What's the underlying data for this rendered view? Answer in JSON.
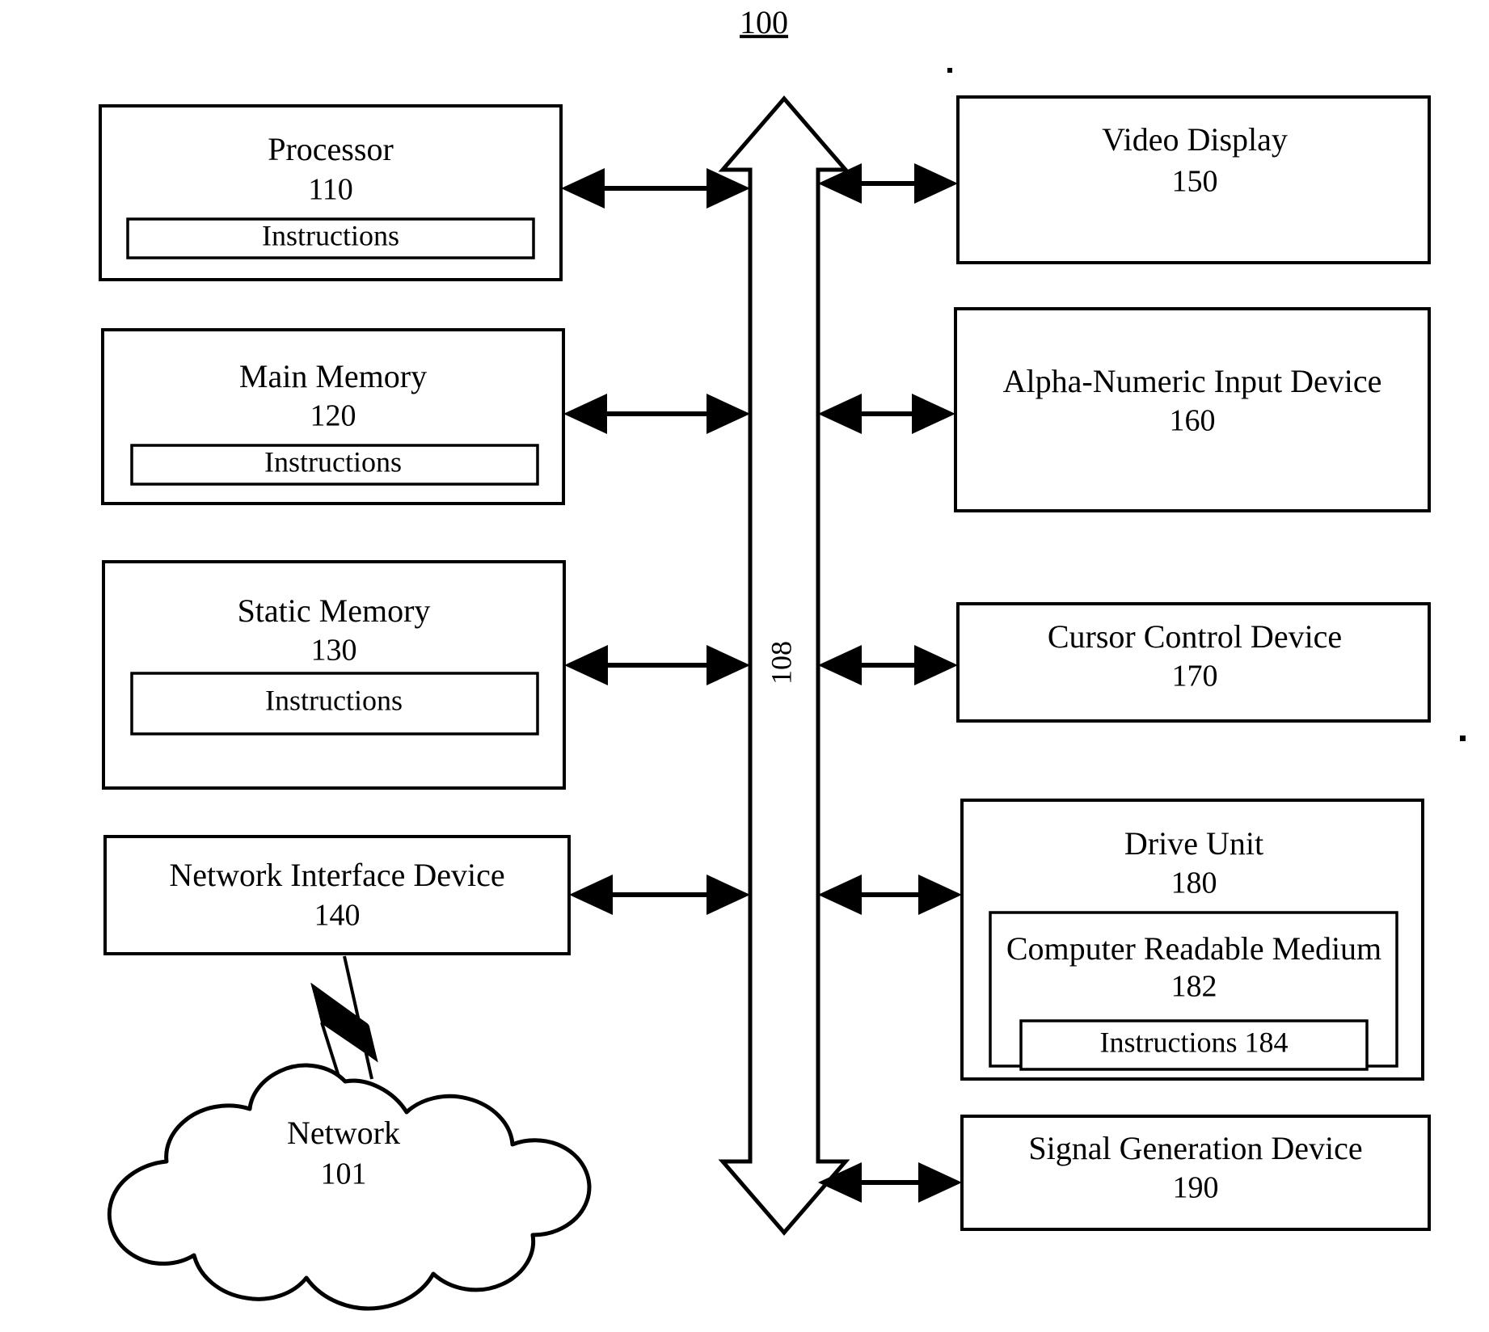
{
  "figure": {
    "number": "100",
    "description": "Computer system block diagram"
  },
  "bus": {
    "label": "108",
    "name": "system-bus"
  },
  "left_column": [
    {
      "id": "processor",
      "title": "Processor",
      "number": "110",
      "inner": {
        "label": "Instructions"
      }
    },
    {
      "id": "main-memory",
      "title": "Main Memory",
      "number": "120",
      "inner": {
        "label": "Instructions"
      }
    },
    {
      "id": "static-memory",
      "title": "Static Memory",
      "number": "130",
      "inner": {
        "label": "Instructions"
      }
    },
    {
      "id": "network-interface-device",
      "title": "Network Interface Device",
      "number": "140",
      "inner": null
    }
  ],
  "right_column": [
    {
      "id": "video-display",
      "title": "Video Display",
      "number": "150"
    },
    {
      "id": "alpha-numeric-input-device",
      "title": "Alpha-Numeric Input Device",
      "number": "160"
    },
    {
      "id": "cursor-control-device",
      "title": "Cursor Control Device",
      "number": "170"
    },
    {
      "id": "drive-unit",
      "title": "Drive Unit",
      "number": "180",
      "medium": {
        "title": "Computer Readable Medium",
        "number": "182",
        "instructions": "Instructions 184"
      }
    },
    {
      "id": "signal-generation-device",
      "title": "Signal Generation Device",
      "number": "190"
    }
  ],
  "network_cloud": {
    "title": "Network",
    "number": "101"
  },
  "colors": {
    "line": "#000000",
    "fill": "#ffffff",
    "text": "#000000"
  },
  "icons": {
    "bus": "double-headed-vertical-arrow",
    "connector": "double-headed-horizontal-arrow",
    "wireless": "lightning-bolt-icon",
    "network": "cloud-icon"
  }
}
